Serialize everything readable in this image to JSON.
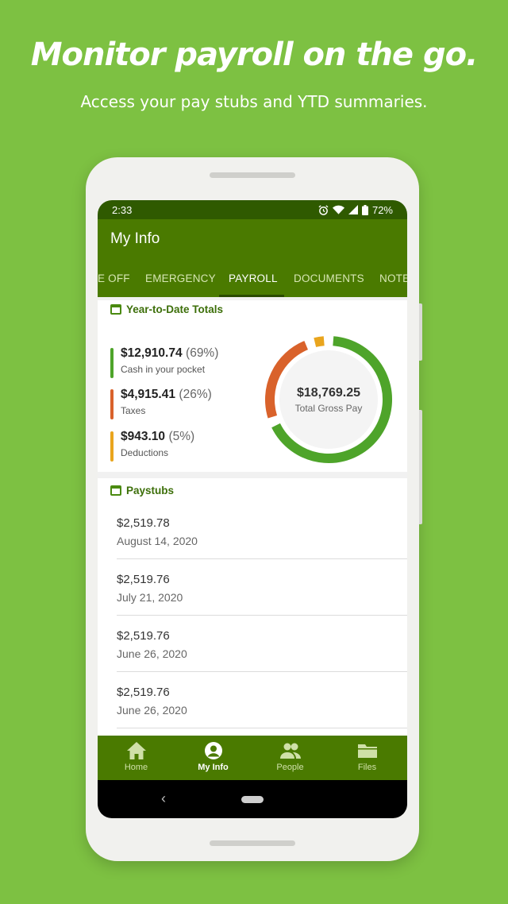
{
  "promo": {
    "headline": "Monitor payroll on the go.",
    "subline": "Access your pay stubs and YTD summaries."
  },
  "status_bar": {
    "time": "2:33",
    "battery": "72%",
    "icons": [
      "alarm-icon",
      "wifi-icon",
      "signal-icon",
      "battery-icon"
    ]
  },
  "app_bar": {
    "title": "My Info"
  },
  "tabs": [
    {
      "label": "E OFF",
      "active": false
    },
    {
      "label": "EMERGENCY",
      "active": false
    },
    {
      "label": "PAYROLL",
      "active": true
    },
    {
      "label": "DOCUMENTS",
      "active": false
    },
    {
      "label": "NOTE",
      "active": false
    }
  ],
  "ytd": {
    "title": "Year-to-Date Totals",
    "items": [
      {
        "amount": "$12,910.74",
        "pct": "(69%)",
        "label": "Cash in your pocket",
        "color": "#4ea42a"
      },
      {
        "amount": "$4,915.41",
        "pct": "(26%)",
        "label": "Taxes",
        "color": "#d9622b"
      },
      {
        "amount": "$943.10",
        "pct": "(5%)",
        "label": "Deductions",
        "color": "#e9a51e"
      }
    ],
    "donut": {
      "total": "$18,769.25",
      "total_label": "Total Gross Pay",
      "fractions": [
        0.69,
        0.26,
        0.05
      ]
    }
  },
  "paystubs": {
    "title": "Paystubs",
    "items": [
      {
        "amount": "$2,519.78",
        "date": "August 14, 2020"
      },
      {
        "amount": "$2,519.76",
        "date": "July 21, 2020"
      },
      {
        "amount": "$2,519.76",
        "date": "June 26, 2020"
      },
      {
        "amount": "$2,519.76",
        "date": "June 26, 2020"
      }
    ]
  },
  "bottom_nav": [
    {
      "label": "Home",
      "icon": "home-icon",
      "active": false
    },
    {
      "label": "My Info",
      "icon": "account-circle-icon",
      "active": true
    },
    {
      "label": "People",
      "icon": "people-icon",
      "active": false
    },
    {
      "label": "Files",
      "icon": "folder-icon",
      "active": false
    }
  ],
  "colors": {
    "background": "#7dc142",
    "app_green": "#4a7a00",
    "status_green": "#2f5a00",
    "accent": "#3d6f0a"
  }
}
